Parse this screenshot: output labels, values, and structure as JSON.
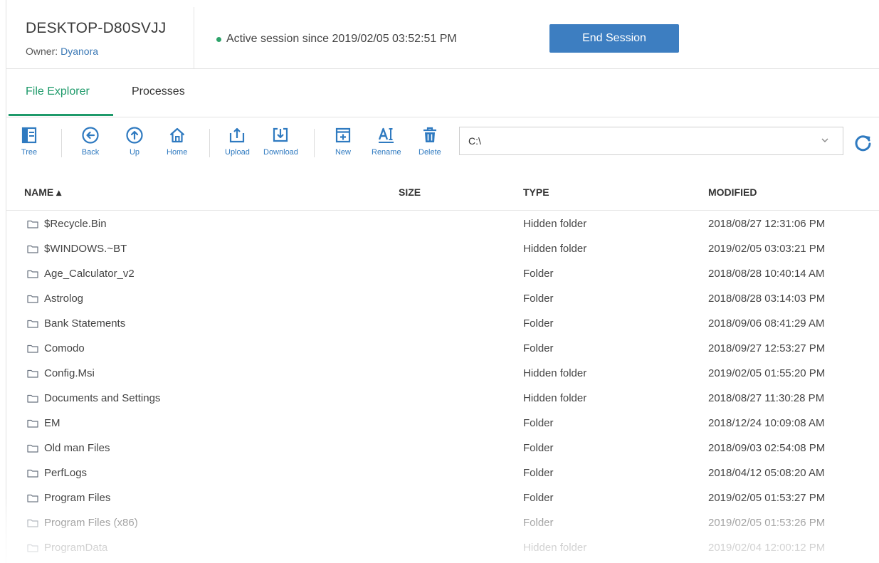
{
  "header": {
    "device_name": "DESKTOP-D80SVJJ",
    "owner_label": "Owner:",
    "owner_name": "Dyanora",
    "session_status": "Active session since 2019/02/05 03:52:51 PM",
    "end_session_label": "End Session",
    "status_color": "#2fa46b",
    "accent_color": "#3d7ec1"
  },
  "tabs": [
    {
      "label": "File Explorer",
      "active": true
    },
    {
      "label": "Processes",
      "active": false
    }
  ],
  "toolbar": {
    "tree": "Tree",
    "back": "Back",
    "up": "Up",
    "home": "Home",
    "upload": "Upload",
    "download": "Download",
    "new": "New",
    "rename": "Rename",
    "delete": "Delete",
    "path_value": "C:\\"
  },
  "table": {
    "columns": {
      "name": "NAME ▴",
      "size": "SIZE",
      "type": "TYPE",
      "modified": "MODIFIED"
    },
    "rows": [
      {
        "name": "$Recycle.Bin",
        "size": "",
        "type": "Hidden folder",
        "modified": "2018/08/27 12:31:06 PM"
      },
      {
        "name": "$WINDOWS.~BT",
        "size": "",
        "type": "Hidden folder",
        "modified": "2019/02/05 03:03:21 PM"
      },
      {
        "name": "Age_Calculator_v2",
        "size": "",
        "type": "Folder",
        "modified": "2018/08/28 10:40:14 AM"
      },
      {
        "name": "Astrolog",
        "size": "",
        "type": "Folder",
        "modified": "2018/08/28 03:14:03 PM"
      },
      {
        "name": "Bank Statements",
        "size": "",
        "type": "Folder",
        "modified": "2018/09/06 08:41:29 AM"
      },
      {
        "name": "Comodo",
        "size": "",
        "type": "Folder",
        "modified": "2018/09/27 12:53:27 PM"
      },
      {
        "name": "Config.Msi",
        "size": "",
        "type": "Hidden folder",
        "modified": "2019/02/05 01:55:20 PM"
      },
      {
        "name": "Documents and Settings",
        "size": "",
        "type": "Hidden folder",
        "modified": "2018/08/27 11:30:28 PM"
      },
      {
        "name": "EM",
        "size": "",
        "type": "Folder",
        "modified": "2018/12/24 10:09:08 AM"
      },
      {
        "name": "Old man Files",
        "size": "",
        "type": "Folder",
        "modified": "2018/09/03 02:54:08 PM"
      },
      {
        "name": "PerfLogs",
        "size": "",
        "type": "Folder",
        "modified": "2018/04/12 05:08:20 AM"
      },
      {
        "name": "Program Files",
        "size": "",
        "type": "Folder",
        "modified": "2019/02/05 01:53:27 PM"
      },
      {
        "name": "Program Files (x86)",
        "size": "",
        "type": "Folder",
        "modified": "2019/02/05 01:53:26 PM"
      },
      {
        "name": "ProgramData",
        "size": "",
        "type": "Hidden folder",
        "modified": "2019/02/04 12:00:12 PM"
      }
    ]
  }
}
